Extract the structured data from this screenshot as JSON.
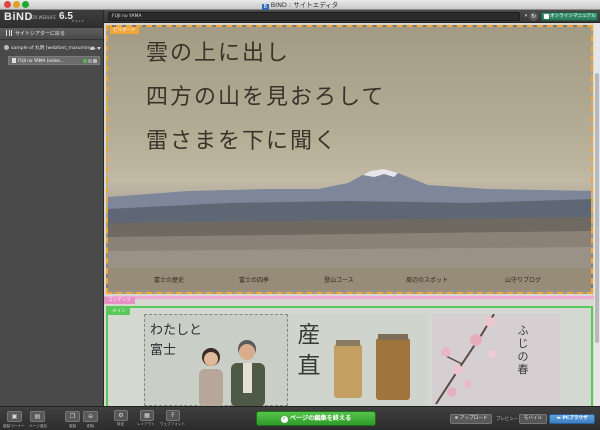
{
  "window": {
    "title": "BIND : サイトエディタ",
    "app_icon": "bind-app-icon"
  },
  "sidebar": {
    "logo": "BiND",
    "logo_sub": "FOR WEBLIFE",
    "version": "6.5",
    "build": "6.x.x.x",
    "back_button": "サイトシアターに戻る",
    "site_name": "sample of 丸明 [webfont_maruminya...",
    "page_name": "FUJI no YAMA (index...",
    "bottom_buttons": [
      {
        "label": "複製コーナー",
        "icon": "duplicate-icon"
      },
      {
        "label": "ページ追加",
        "icon": "add-page-icon"
      },
      {
        "label": "複製",
        "icon": "copy-icon"
      },
      {
        "label": "削除",
        "icon": "delete-icon"
      }
    ]
  },
  "urlbar": {
    "url": "FUJI no YAMA",
    "manual_button": "オンラインマニュアル"
  },
  "billboard": {
    "tag": "ビルボード",
    "lines": [
      "雲の上に出し",
      "四方の山を見おろして",
      "雷さまを下に聞く"
    ],
    "nav": [
      "富士の歴史",
      "富士の四季",
      "登山コース",
      "周辺のスポット",
      "山守りブログ"
    ]
  },
  "contents": {
    "tag": "コンテンツ",
    "main_tag": "メイン",
    "tile1": {
      "line1": "わたしと",
      "line2": "富士"
    },
    "tile2": {
      "kanji": "産直"
    },
    "tile3": {
      "text": "ふじの春"
    }
  },
  "bottombar": {
    "tools": [
      {
        "label": "設定",
        "icon": "gear-icon"
      },
      {
        "label": "レイアウト",
        "icon": "layout-icon"
      },
      {
        "label": "ウェブフォント",
        "icon": "font-icon"
      }
    ],
    "finish_button": "ページの編集を終える",
    "upload_button": "アップロード",
    "preview_label": "プレビュー",
    "mobile_button": "モバイル",
    "pc_button": "PCブラウザ"
  }
}
